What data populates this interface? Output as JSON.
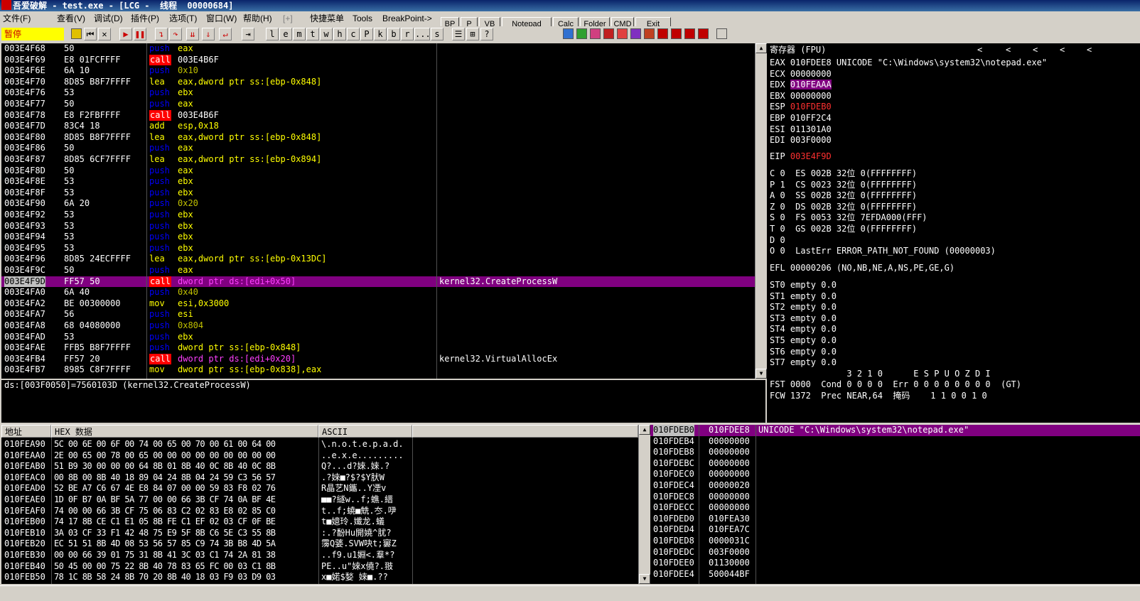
{
  "window": {
    "title": "吾爱破解 - test.exe - [LCG -  线程  00000684]"
  },
  "menu": [
    "文件(F)",
    "查看(V)",
    "调试(D)",
    "插件(P)",
    "选项(T)",
    "窗口(W)",
    "帮助(H)",
    "[+]",
    "快捷菜单",
    "Tools",
    "BreakPoint->"
  ],
  "quick_buttons": [
    "BP",
    "P",
    "VB",
    "Notepad",
    "Calc",
    "Folder",
    "CMD",
    "Exit"
  ],
  "status": "暂停",
  "toolbar_letters": [
    "l",
    "e",
    "m",
    "t",
    "w",
    "h",
    "c",
    "P",
    "k",
    "b",
    "r",
    "...",
    "s"
  ],
  "disasm": [
    {
      "addr": "003E4F68",
      "hex": "50",
      "mn": "push",
      "op": "eax",
      "cm": ""
    },
    {
      "addr": "003E4F69",
      "hex": "E8 01FCFFFF",
      "mn": "call",
      "op": "003E4B6F",
      "cm": ""
    },
    {
      "addr": "003E4F6E",
      "hex": "6A 10",
      "mn": "push",
      "op": "0x10",
      "cm": ""
    },
    {
      "addr": "003E4F70",
      "hex": "8D85 B8F7FFFF",
      "mn": "lea",
      "op": "eax,dword ptr ss:[ebp-0x848]",
      "cm": ""
    },
    {
      "addr": "003E4F76",
      "hex": "53",
      "mn": "push",
      "op": "ebx",
      "cm": ""
    },
    {
      "addr": "003E4F77",
      "hex": "50",
      "mn": "push",
      "op": "eax",
      "cm": ""
    },
    {
      "addr": "003E4F78",
      "hex": "E8 F2FBFFFF",
      "mn": "call",
      "op": "003E4B6F",
      "cm": ""
    },
    {
      "addr": "003E4F7D",
      "hex": "83C4 18",
      "mn": "add",
      "op": "esp,0x18",
      "cm": ""
    },
    {
      "addr": "003E4F80",
      "hex": "8D85 B8F7FFFF",
      "mn": "lea",
      "op": "eax,dword ptr ss:[ebp-0x848]",
      "cm": ""
    },
    {
      "addr": "003E4F86",
      "hex": "50",
      "mn": "push",
      "op": "eax",
      "cm": ""
    },
    {
      "addr": "003E4F87",
      "hex": "8D85 6CF7FFFF",
      "mn": "lea",
      "op": "eax,dword ptr ss:[ebp-0x894]",
      "cm": ""
    },
    {
      "addr": "003E4F8D",
      "hex": "50",
      "mn": "push",
      "op": "eax",
      "cm": ""
    },
    {
      "addr": "003E4F8E",
      "hex": "53",
      "mn": "push",
      "op": "ebx",
      "cm": ""
    },
    {
      "addr": "003E4F8F",
      "hex": "53",
      "mn": "push",
      "op": "ebx",
      "cm": ""
    },
    {
      "addr": "003E4F90",
      "hex": "6A 20",
      "mn": "push",
      "op": "0x20",
      "cm": ""
    },
    {
      "addr": "003E4F92",
      "hex": "53",
      "mn": "push",
      "op": "ebx",
      "cm": ""
    },
    {
      "addr": "003E4F93",
      "hex": "53",
      "mn": "push",
      "op": "ebx",
      "cm": ""
    },
    {
      "addr": "003E4F94",
      "hex": "53",
      "mn": "push",
      "op": "ebx",
      "cm": ""
    },
    {
      "addr": "003E4F95",
      "hex": "53",
      "mn": "push",
      "op": "ebx",
      "cm": ""
    },
    {
      "addr": "003E4F96",
      "hex": "8D85 24ECFFFF",
      "mn": "lea",
      "op": "eax,dword ptr ss:[ebp-0x13DC]",
      "cm": ""
    },
    {
      "addr": "003E4F9C",
      "hex": "50",
      "mn": "push",
      "op": "eax",
      "cm": ""
    },
    {
      "addr": "003E4F9D",
      "hex": "FF57 50",
      "mn": "call",
      "op": "dword ptr ds:[edi+0x50]",
      "cm": "kernel32.CreateProcessW",
      "sel": true
    },
    {
      "addr": "003E4FA0",
      "hex": "6A 40",
      "mn": "push",
      "op": "0x40",
      "cm": ""
    },
    {
      "addr": "003E4FA2",
      "hex": "BE 00300000",
      "mn": "mov",
      "op": "esi,0x3000",
      "cm": ""
    },
    {
      "addr": "003E4FA7",
      "hex": "56",
      "mn": "push",
      "op": "esi",
      "cm": ""
    },
    {
      "addr": "003E4FA8",
      "hex": "68 04080000",
      "mn": "push",
      "op": "0x804",
      "cm": ""
    },
    {
      "addr": "003E4FAD",
      "hex": "53",
      "mn": "push",
      "op": "ebx",
      "cm": ""
    },
    {
      "addr": "003E4FAE",
      "hex": "FFB5 B8F7FFFF",
      "mn": "push",
      "op": "dword ptr ss:[ebp-0x848]",
      "cm": ""
    },
    {
      "addr": "003E4FB4",
      "hex": "FF57 20",
      "mn": "call",
      "op": "dword ptr ds:[edi+0x20]",
      "cm": "kernel32.VirtualAllocEx"
    },
    {
      "addr": "003E4FB7",
      "hex": "8985 C8F7FFFF",
      "mn": "mov",
      "op": "dword ptr ss:[ebp-0x838],eax",
      "cm": ""
    }
  ],
  "info_line": "ds:[003F0050]=7560103D (kernel32.CreateProcessW)",
  "registers": {
    "header": "寄存器 (FPU)",
    "arrows": [
      "<",
      "<",
      "<",
      "<",
      "<"
    ],
    "lines": [
      {
        "t": "EAX 010FDEE8 UNICODE \"C:\\Windows\\system32\\notepad.exe\""
      },
      {
        "t": "ECX 00000000"
      },
      {
        "t": "EDX ",
        "v": "010FEAAA",
        "style": "purple"
      },
      {
        "t": "EBX 00000000"
      },
      {
        "t": "ESP ",
        "v": "010FDEB0",
        "style": "red"
      },
      {
        "t": "EBP 010FF2C4"
      },
      {
        "t": "ESI 011301A0"
      },
      {
        "t": "EDI 003F0000"
      },
      {
        "t": ""
      },
      {
        "t": "EIP ",
        "v": "003E4F9D",
        "style": "red"
      },
      {
        "t": ""
      },
      {
        "t": "C 0  ES 002B 32位 0(FFFFFFFF)"
      },
      {
        "t": "P 1  CS 0023 32位 0(FFFFFFFF)"
      },
      {
        "t": "A 0  SS 002B 32位 0(FFFFFFFF)"
      },
      {
        "t": "Z 0  DS 002B 32位 0(FFFFFFFF)"
      },
      {
        "t": "S 0  FS 0053 32位 7EFDA000(FFF)"
      },
      {
        "t": "T 0  GS 002B 32位 0(FFFFFFFF)"
      },
      {
        "t": "D 0"
      },
      {
        "t": "O 0  LastErr ERROR_PATH_NOT_FOUND (00000003)"
      },
      {
        "t": ""
      },
      {
        "t": "EFL 00000206 (NO,NB,NE,A,NS,PE,GE,G)"
      },
      {
        "t": ""
      },
      {
        "t": "ST0 empty 0.0"
      },
      {
        "t": "ST1 empty 0.0"
      },
      {
        "t": "ST2 empty 0.0"
      },
      {
        "t": "ST3 empty 0.0"
      },
      {
        "t": "ST4 empty 0.0"
      },
      {
        "t": "ST5 empty 0.0"
      },
      {
        "t": "ST6 empty 0.0"
      },
      {
        "t": "ST7 empty 0.0"
      },
      {
        "t": "               3 2 1 0      E S P U O Z D I"
      },
      {
        "t": "FST 0000  Cond 0 0 0 0  Err 0 0 0 0 0 0 0 0  (GT)"
      },
      {
        "t": "FCW 1372  Prec NEAR,64  掩码    1 1 0 0 1 0"
      }
    ]
  },
  "dump": {
    "headers": {
      "addr": "地址",
      "hex": "HEX 数据",
      "ascii": "ASCII"
    },
    "rows": [
      {
        "a": "010FEA90",
        "h": "5C 00 6E 00 6F 00 74 00 65 00 70 00 61 00 64 00",
        "s": "\\.n.o.t.e.p.a.d."
      },
      {
        "a": "010FEAA0",
        "h": "2E 00 65 00 78 00 65 00 00 00 00 00 00 00 00 00",
        "s": "..e.x.e........."
      },
      {
        "a": "010FEAB0",
        "h": "51 B9 30 00 00 00 64 8B 01 8B 40 0C 8B 40 0C 8B",
        "s": "Q?...d?婡.婡.?"
      },
      {
        "a": "010FEAC0",
        "h": "00 8B 00 8B 40 18 89 04 24 8B 04 24 59 C3 56 57",
        "s": ".?婡■?$?$Y肰W"
      },
      {
        "a": "010FEAD0",
        "h": "52 BE A7 C6 67 4E E8 84 07 00 00 59 83 F8 02 76",
        "s": "R晶艺N鑴..Y凐v"
      },
      {
        "a": "010FEAE0",
        "h": "1D 0F B7 0A BF 5A 77 00 00 66 3B CF 74 0A BF 4E",
        "s": "■■?繸w..f;蟭.縉"
      },
      {
        "a": "010FEAF0",
        "h": "74 00 00 66 3B CF 75 06 83 C2 02 83 E8 02 85 C0",
        "s": "t..f;蟯■兟.冭.吚"
      },
      {
        "a": "010FEB00",
        "h": "74 17 8B CE C1 E1 05 8B FE C1 EF 02 03 CF 0F BE",
        "s": "t■嬑玲.孅龙.蟻"
      },
      {
        "a": "010FEB10",
        "h": "3A 03 CF 33 F1 42 48 75 E9 5F 8B C6 5E C3 55 8B",
        "s": ":.?馚Hu開嬈^肬?"
      },
      {
        "a": "010FEB20",
        "h": "EC 51 51 8B 4D 08 53 56 57 85 C9 74 3B B8 4D 5A",
        "s": "霶Q婱.SVW吷t;窶Z"
      },
      {
        "a": "010FEB30",
        "h": "00 00 66 39 01 75 31 8B 41 3C 03 C1 74 2A 81 38",
        "s": "..f9.u1婣<.羣*?"
      },
      {
        "a": "010FEB40",
        "h": "50 45 00 00 75 22 8B 40 78 83 65 FC 00 03 C1 8B",
        "s": "PE..u\"婡x僥?.翄"
      },
      {
        "a": "010FEB50",
        "h": "78 1C 8B 58 24 8B 70 20 8B 40 18 03 F9 03 D9 03",
        "s": "x■婼$媝 婡■.??"
      }
    ]
  },
  "stack": [
    {
      "a": "010FDEB0",
      "v": "010FDEE8",
      "c": "UNICODE \"C:\\Windows\\system32\\notepad.exe\"",
      "sel": true
    },
    {
      "a": "010FDEB4",
      "v": "00000000",
      "c": ""
    },
    {
      "a": "010FDEB8",
      "v": "00000000",
      "c": ""
    },
    {
      "a": "010FDEBC",
      "v": "00000000",
      "c": ""
    },
    {
      "a": "010FDEC0",
      "v": "00000000",
      "c": ""
    },
    {
      "a": "010FDEC4",
      "v": "00000020",
      "c": ""
    },
    {
      "a": "010FDEC8",
      "v": "00000000",
      "c": ""
    },
    {
      "a": "010FDECC",
      "v": "00000000",
      "c": ""
    },
    {
      "a": "010FDED0",
      "v": "010FEA30",
      "c": ""
    },
    {
      "a": "010FDED4",
      "v": "010FEA7C",
      "c": ""
    },
    {
      "a": "010FDED8",
      "v": "0000031C",
      "c": ""
    },
    {
      "a": "010FDEDC",
      "v": "003F0000",
      "c": ""
    },
    {
      "a": "010FDEE0",
      "v": "01130000",
      "c": ""
    },
    {
      "a": "010FDEE4",
      "v": "500044BF",
      "c": ""
    }
  ]
}
